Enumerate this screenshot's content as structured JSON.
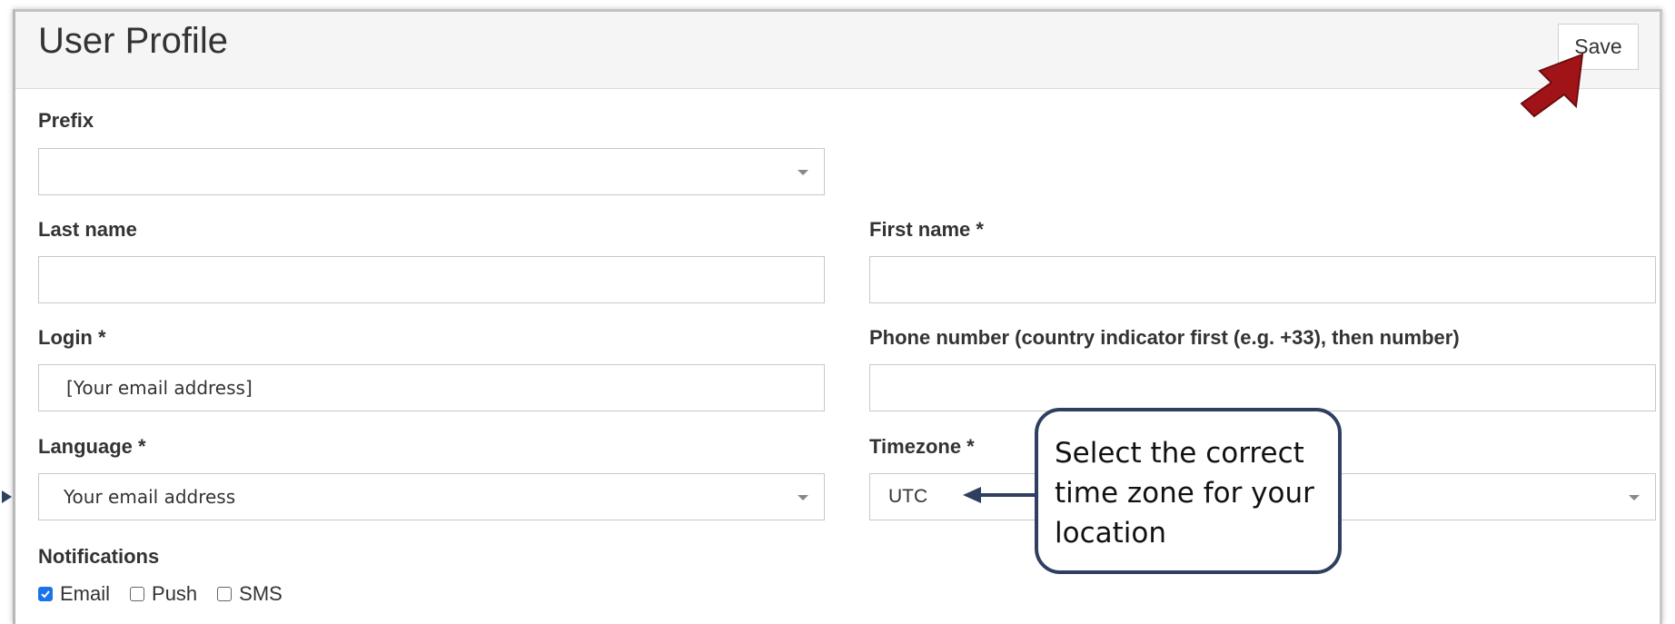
{
  "header": {
    "title": "User Profile",
    "save_label": "Save"
  },
  "form": {
    "prefix": {
      "label": "Prefix",
      "value": ""
    },
    "last_name": {
      "label": "Last name",
      "value": ""
    },
    "first_name": {
      "label": "First name *",
      "value": ""
    },
    "login": {
      "label": "Login *",
      "value": "[Your email address]"
    },
    "phone": {
      "label": "Phone number (country indicator first (e.g. +33), then number)",
      "value": ""
    },
    "language": {
      "label": "Language *",
      "value": "Your email address"
    },
    "timezone": {
      "label": "Timezone *",
      "value": "UTC"
    },
    "notifications": {
      "label": "Notifications",
      "options": [
        {
          "label": "Email",
          "checked": true
        },
        {
          "label": "Push",
          "checked": false
        },
        {
          "label": "SMS",
          "checked": false
        }
      ]
    }
  },
  "annotation": {
    "callout_text": "Select the correct time zone for your location",
    "arrow_color": "#2e3f5f",
    "save_pointer_color": "#a01418"
  },
  "colors": {
    "header_bg": "#f5f5f5",
    "checkbox_accent": "#1a73e8",
    "callout_border": "#2e3f5f"
  },
  "icons": [
    "chevron-down-icon",
    "checkmark-icon",
    "red-pointer-arrow-icon",
    "callout-arrow-icon"
  ]
}
